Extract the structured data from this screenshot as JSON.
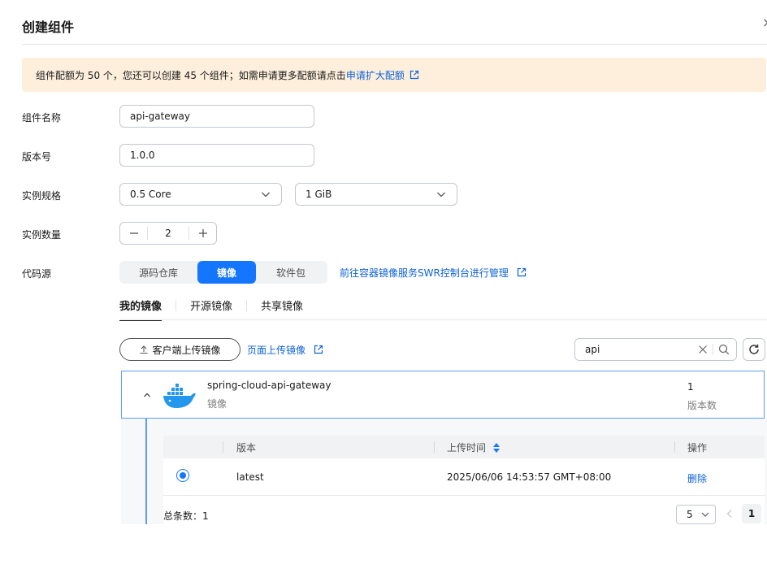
{
  "dialog": {
    "title": "创建组件",
    "close": "×"
  },
  "notice": {
    "text": "组件配额为 50 个，您还可以创建 45 个组件；如需申请更多配额请点击",
    "link": "申请扩大配额"
  },
  "form": {
    "name": {
      "label": "组件名称",
      "value": "api-gateway"
    },
    "version": {
      "label": "版本号",
      "value": "1.0.0"
    },
    "spec": {
      "label": "实例规格",
      "cpu": "0.5 Core",
      "memory": "1 GiB"
    },
    "count": {
      "label": "实例数量",
      "value": "2",
      "minus": "—",
      "plus": "+"
    },
    "source": {
      "label": "代码源",
      "options": [
        "源码仓库",
        "镜像",
        "软件包"
      ],
      "selected": "镜像",
      "swr_link": "前往容器镜像服务SWR控制台进行管理"
    }
  },
  "image_tabs": [
    "我的镜像",
    "开源镜像",
    "共享镜像"
  ],
  "toolbar": {
    "client_upload": "客户端上传镜像",
    "page_upload": "页面上传镜像",
    "search_value": "api"
  },
  "image": {
    "name": "spring-cloud-api-gateway",
    "type": "镜像",
    "version_count": "1",
    "version_count_label": "版本数",
    "table": {
      "headers": [
        "版本",
        "上传时间",
        "操作"
      ],
      "rows": [
        {
          "version": "latest",
          "uploaded": "2025/06/06 14:53:57 GMT+08:00",
          "action": "删除"
        }
      ]
    }
  },
  "pagination": {
    "total": "总条数：1",
    "page_size": "5",
    "current_page": "1"
  },
  "colors": {
    "primary": "#1476ff",
    "link": "#0d61d9",
    "notice_bg": "#fdefdc"
  }
}
